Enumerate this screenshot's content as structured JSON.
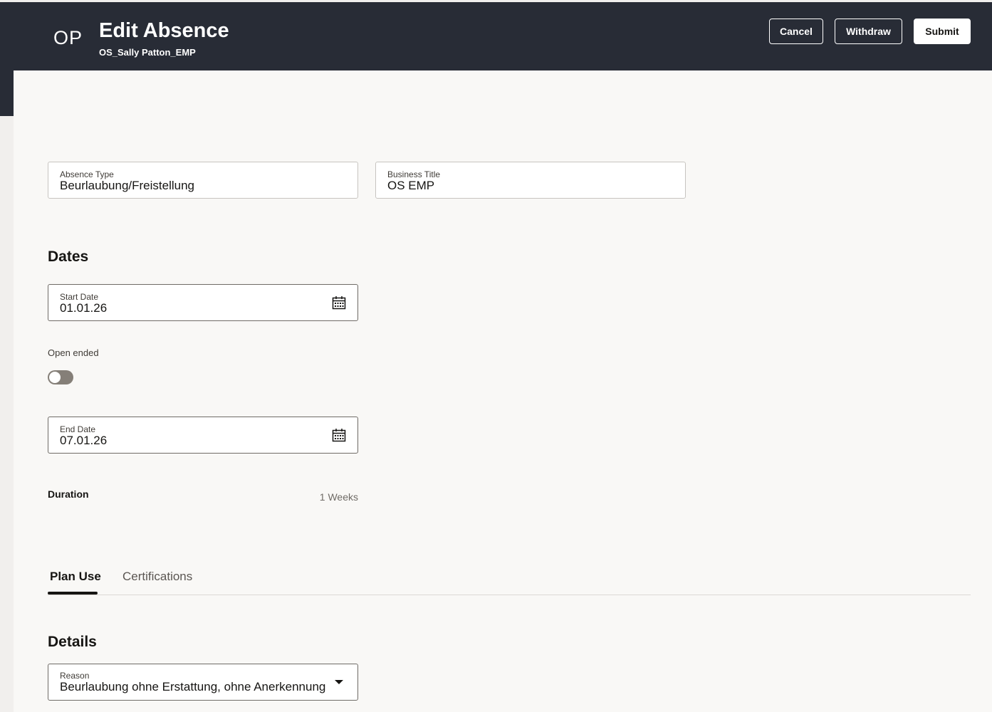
{
  "header": {
    "avatar_initials": "OP",
    "title": "Edit Absence",
    "subtitle": "OS_Sally Patton_EMP",
    "cancel_label": "Cancel",
    "withdraw_label": "Withdraw",
    "submit_label": "Submit"
  },
  "absence_type": {
    "label": "Absence Type",
    "value": "Beurlaubung/Freistellung"
  },
  "business_title": {
    "label": "Business Title",
    "value": "OS EMP"
  },
  "dates": {
    "section_title": "Dates",
    "start_date": {
      "label": "Start Date",
      "value": "01.01.26"
    },
    "open_ended": {
      "label": "Open ended",
      "checked": false
    },
    "end_date": {
      "label": "End Date",
      "value": "07.01.26"
    },
    "duration": {
      "label": "Duration",
      "value": "1 Weeks"
    }
  },
  "tabs": [
    {
      "label": "Plan Use",
      "active": true
    },
    {
      "label": "Certifications",
      "active": false
    }
  ],
  "details": {
    "section_title": "Details",
    "reason": {
      "label": "Reason",
      "value": "Beurlaubung ohne Erstattung, ohne Anerkennung"
    }
  },
  "colors": {
    "header_bg": "#282c36",
    "panel_bg": "#f9f8f6",
    "toggle_off": "#857f78"
  },
  "icons": {
    "date_picker": "calendar-icon",
    "dropdown": "chevron-down-icon"
  }
}
